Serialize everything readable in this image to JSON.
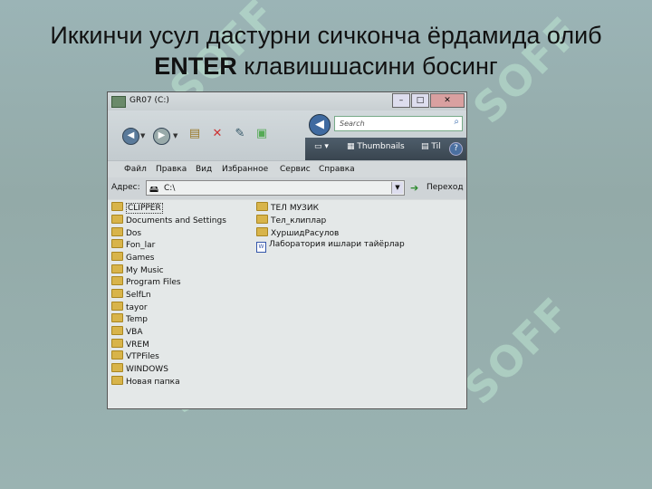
{
  "slide": {
    "title_line1": "Иккинчи усул дастурни сичконча ёрдамида олиб",
    "title_bold": "ENTER",
    "title_line2_rest": " клавишшасини босинг",
    "watermark": "SOFF"
  },
  "window": {
    "title": "GR07 (C:)",
    "search_placeholder": "Search",
    "view_label": "Thumbnails",
    "view_more": "Til",
    "menu": [
      "Файл",
      "Правка",
      "Вид",
      "Избранное",
      "Сервис",
      "Справка"
    ],
    "address_label": "Адрес:",
    "address_value": "C:\\",
    "go_label": "Переход"
  },
  "files": {
    "column1": [
      "CLIPPER",
      "Documents and Settings",
      "Dos",
      "Fon_lar",
      "Games",
      "My Music",
      "Program Files",
      "SelfLn",
      "tayor",
      "Temp",
      "VBA",
      "VREM",
      "VTPFiles",
      "WINDOWS",
      "Новая папка"
    ],
    "column2_folders": [
      "ТЕЛ МУЗИК",
      "Тел_клиплар",
      "ХуршидРасулов"
    ],
    "column2_doc": "Лаборатория ишлари тайёрлар",
    "selected": "CLIPPER"
  },
  "colors": {
    "background": "#9bb4b6",
    "view_bar": "#4e5d6b",
    "close_button": "#d9a0a0",
    "folder": "#d8b44a"
  },
  "icons": [
    "back-arrow-icon",
    "forward-arrow-icon",
    "folder-icon",
    "close-icon",
    "search-icon",
    "help-icon",
    "go-arrow-icon",
    "document-icon",
    "drive-icon"
  ]
}
